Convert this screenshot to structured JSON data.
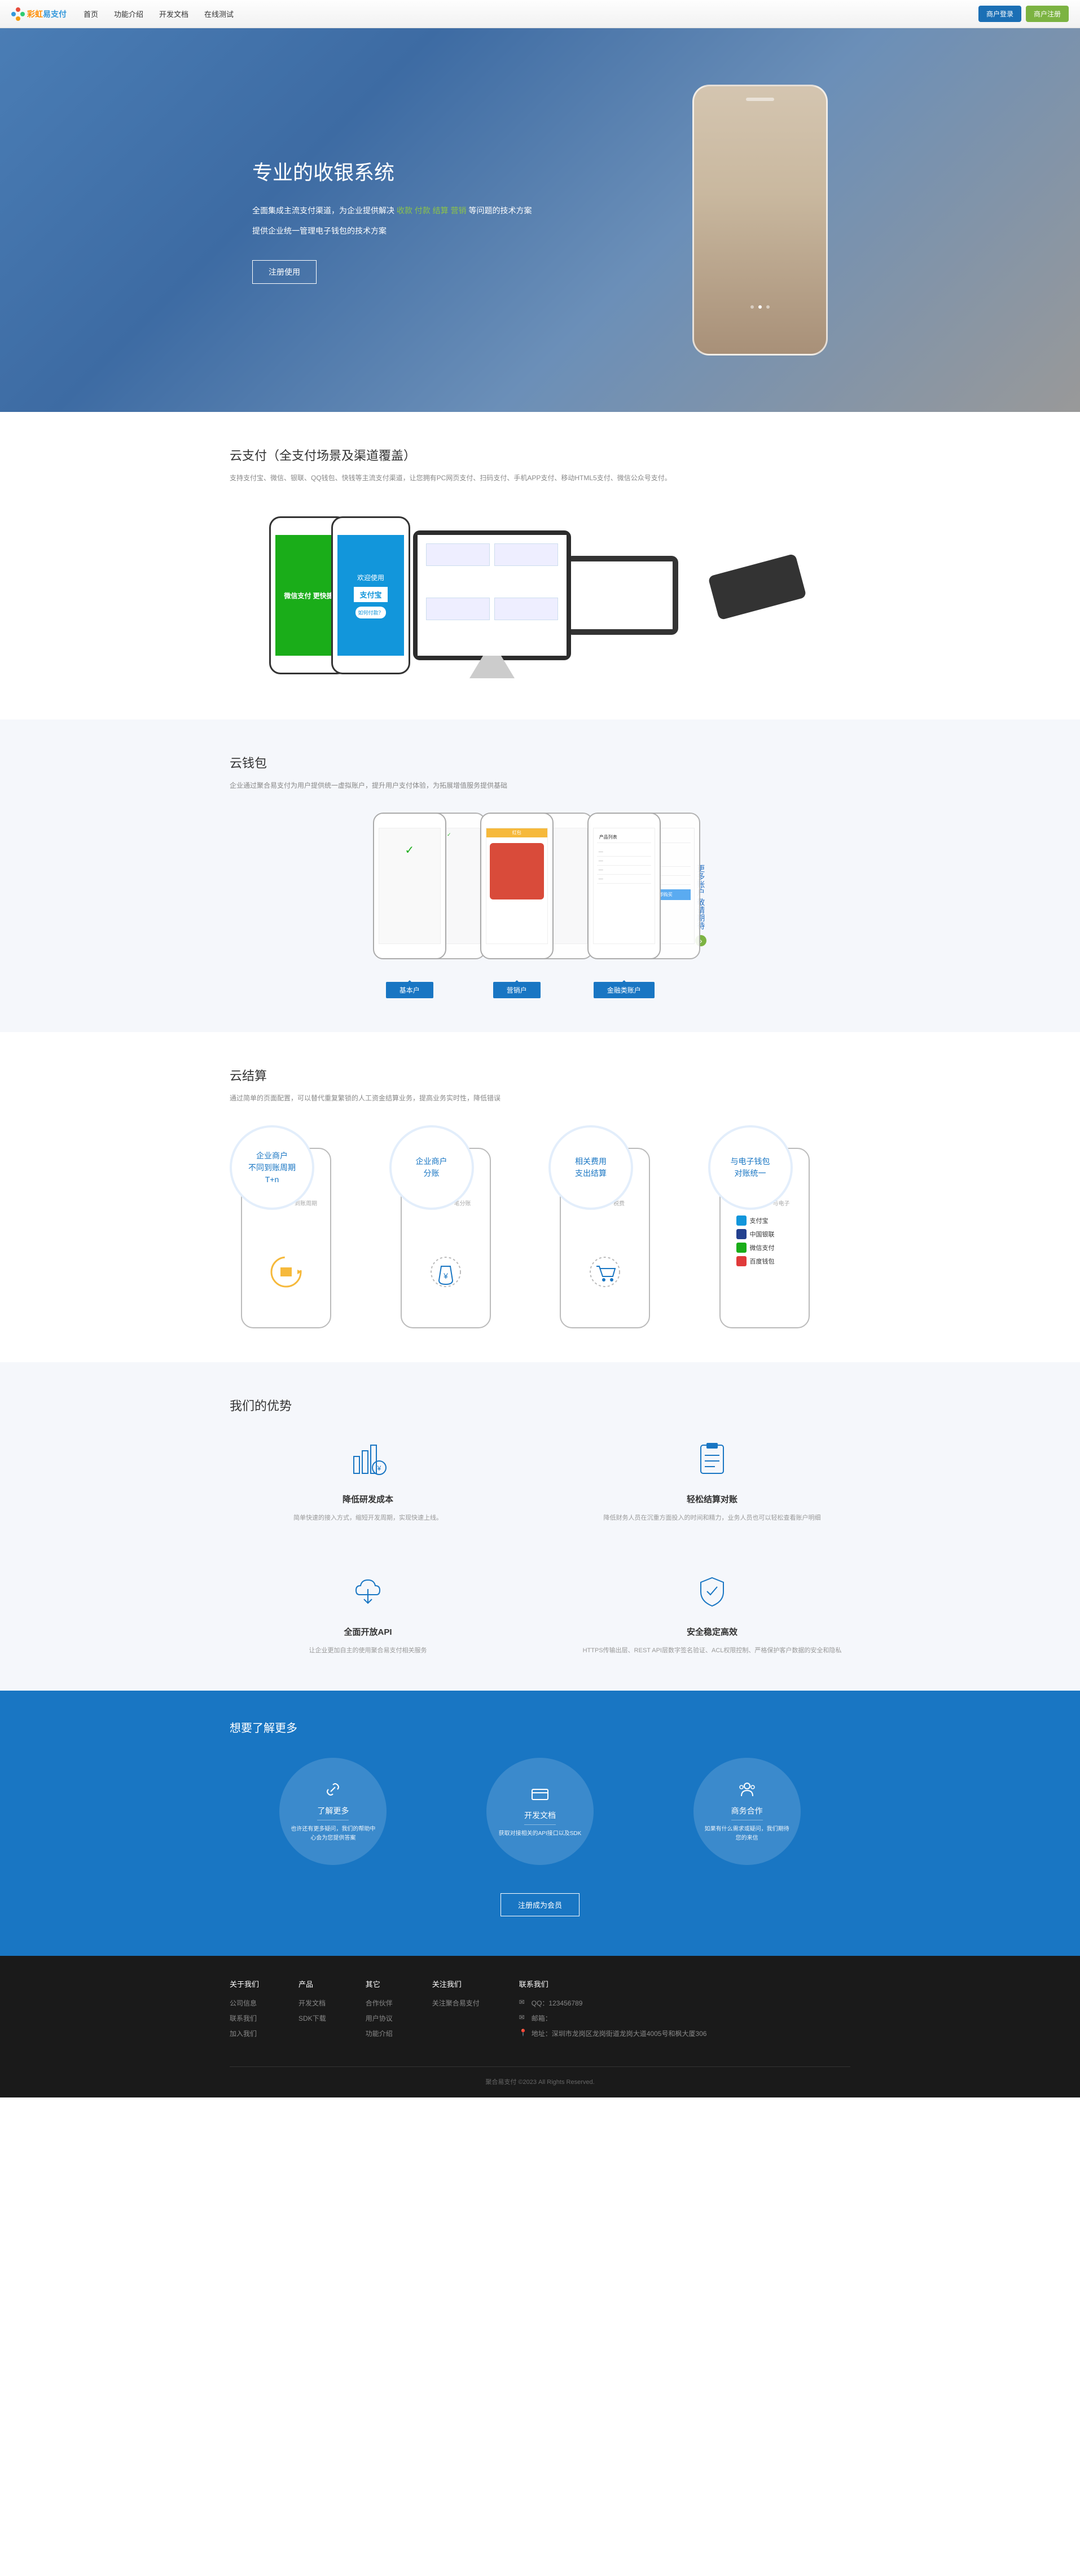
{
  "brand": {
    "name_prefix": "彩虹",
    "name_suffix": "易支付"
  },
  "nav": [
    "首页",
    "功能介绍",
    "开发文档",
    "在线测试"
  ],
  "header_buttons": {
    "login": "商户登录",
    "register": "商户注册"
  },
  "hero": {
    "title": "专业的收银系统",
    "line1_a": "全面集成主流支付渠道，为企业提供解决 ",
    "line1_hl": "收款 付款 结算 营销",
    "line1_b": " 等问题的技术方案",
    "line2": "提供企业统一管理电子钱包的技术方案",
    "btn": "注册使用"
  },
  "cloudpay": {
    "title": "云支付（全支付场景及渠道覆盖）",
    "sub": "支持支付宝、微信、银联、QQ钱包、快钱等主流支付渠道，让您拥有PC网页支付、扫码支付、手机APP支付、移动HTML5支付、微信公众号支付。",
    "wechat_label": "微信支付  更快捷",
    "alipay_top": "欢迎使用",
    "alipay_brand": "支付宝",
    "alipay_btn": "如何付款？"
  },
  "wallet": {
    "title": "云钱包",
    "sub": "企业通过聚合易支付为用户提供统一虚拟账户，提升用户支付体验，为拓展增值服务提供基础",
    "tags": [
      "基本户",
      "营销户",
      "金融类账户"
    ],
    "more_text": "更多账户 敬请期待"
  },
  "settle": {
    "title": "云结算",
    "sub": "通过简单的页面配置，可以替代重复繁锁的人工资金结算业务，提高业务实时性，降低错误",
    "items": [
      {
        "badge_l1": "企业商户",
        "badge_l2": "不同到账周期",
        "badge_l3": "T+n",
        "sub": "到账周期"
      },
      {
        "badge_l1": "企业商户",
        "badge_l2": "分账",
        "sub": "笔分账"
      },
      {
        "badge_l1": "相关费用",
        "badge_l2": "支出结算",
        "sub": "税费"
      },
      {
        "badge_l1": "与电子钱包",
        "badge_l2": "对账统一",
        "sub": "与电子"
      }
    ],
    "wallets": [
      {
        "name": "支付宝",
        "color": "#1296db"
      },
      {
        "name": "中国银联",
        "color": "#23408e"
      },
      {
        "name": "微信支付",
        "color": "#1aad19"
      },
      {
        "name": "百度钱包",
        "color": "#e03a3a"
      }
    ]
  },
  "advantage": {
    "title": "我们的优势",
    "items": [
      {
        "title": "降低研发成本",
        "desc": "简单快速的接入方式，缩短开发周期，实现快速上线。"
      },
      {
        "title": "轻松结算对账",
        "desc": "降低财务人员在沉重方面投入的时间和精力，业务人员也可以轻松查看账户明细"
      },
      {
        "title": "全面开放API",
        "desc": "让企业更加自主的使用聚合易支付相关服务"
      },
      {
        "title": "安全稳定高效",
        "desc": "HTTPS传输出层、REST API层数字签名验证、ACL权限控制、严格保护客户数据的安全和隐私"
      }
    ]
  },
  "more": {
    "title": "想要了解更多",
    "items": [
      {
        "title": "了解更多",
        "desc": "也许还有更多疑问，我们的帮助中心会为您提供答案"
      },
      {
        "title": "开发文档",
        "desc": "获取对接相关的API接口以及SDK"
      },
      {
        "title": "商务合作",
        "desc": "如果有什么需求或疑问，我们期待您的来信"
      }
    ],
    "btn": "注册成为会员"
  },
  "footer": {
    "cols": [
      {
        "title": "关于我们",
        "items": [
          "公司信息",
          "联系我们",
          "加入我们"
        ]
      },
      {
        "title": "产品",
        "items": [
          "开发文档",
          "SDK下载"
        ]
      },
      {
        "title": "其它",
        "items": [
          "合作伙伴",
          "用户协议",
          "功能介绍"
        ]
      },
      {
        "title": "关注我们",
        "items": [
          "关注聚合易支付"
        ]
      }
    ],
    "contact_title": "联系我们",
    "contact": [
      {
        "icon": "qq",
        "label": "QQ：",
        "value": "123456789"
      },
      {
        "icon": "mail",
        "label": "邮箱：",
        "value": ""
      },
      {
        "icon": "pin",
        "label": "地址：",
        "value": "深圳市龙岗区龙岗街道龙岗大道4005号和枫大厦306"
      }
    ],
    "copyright": "聚合易支付 ©2023 All Rights Reserved."
  }
}
